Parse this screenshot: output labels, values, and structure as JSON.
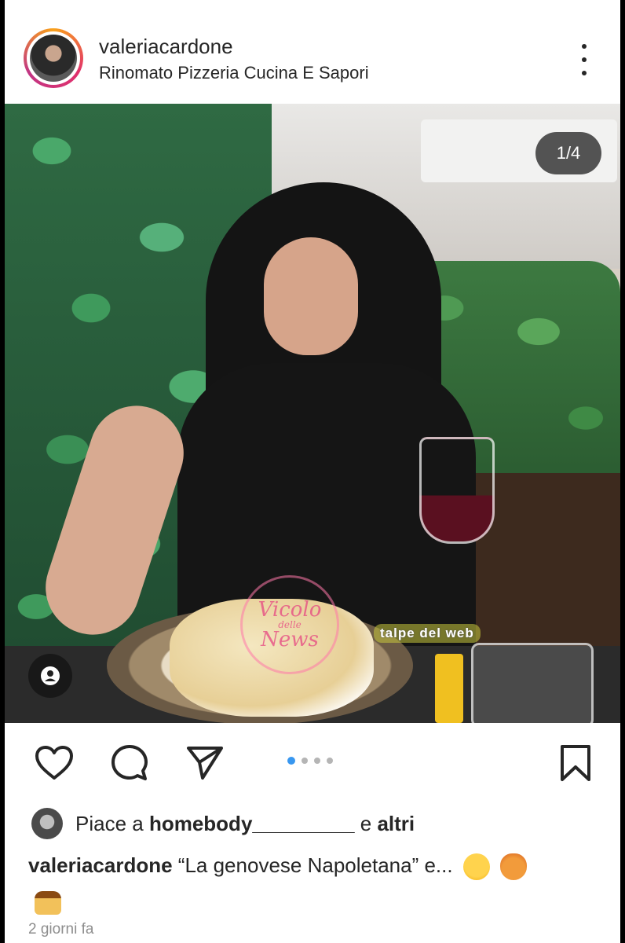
{
  "post": {
    "username": "valeriacardone",
    "location": "Rinomato Pizzeria Cucina E Sapori",
    "image_counter": "1/4",
    "carousel_total": 4,
    "carousel_active": 1,
    "likes_prefix": "Piace a ",
    "likes_user": "homebody_________",
    "likes_suffix": " e ",
    "likes_others": "altri",
    "caption_text": "“La genovese Napoletana” e...",
    "timestamp": "2 giorni fa"
  },
  "watermarks": {
    "circle_main": "Vicolo",
    "circle_small": "delle",
    "circle_bottom": "News",
    "badge": "talpe del web"
  },
  "icons": {
    "more": "more-vertical-icon",
    "like": "heart-icon",
    "comment": "comment-icon",
    "share": "send-icon",
    "save": "bookmark-icon",
    "tags": "user-tag-icon"
  },
  "colors": {
    "carousel_active": "#3897f0",
    "carousel_inactive": "#b5b5b5",
    "text": "#262626",
    "muted": "#8e8e8e"
  }
}
